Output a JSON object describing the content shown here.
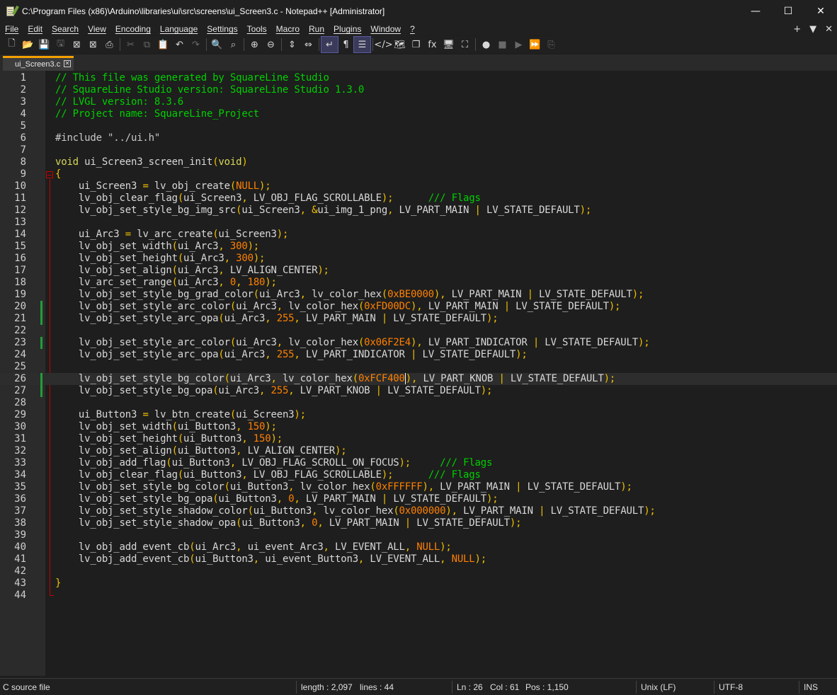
{
  "window": {
    "title": "C:\\Program Files (x86)\\Arduino\\libraries\\ui\\src\\screens\\ui_Screen3.c - Notepad++ [Administrator]",
    "controls": {
      "minimize": "—",
      "maximize": "☐",
      "close": "✕"
    }
  },
  "menu": {
    "items": [
      "File",
      "Edit",
      "Search",
      "View",
      "Encoding",
      "Language",
      "Settings",
      "Tools",
      "Macro",
      "Run",
      "Plugins",
      "Window",
      "?"
    ],
    "right": [
      "+",
      "▼",
      "✕"
    ]
  },
  "toolbar": {
    "icons": [
      {
        "name": "new-file-icon",
        "glyph": "🗋"
      },
      {
        "name": "open-file-icon",
        "glyph": "📂"
      },
      {
        "name": "save-icon",
        "glyph": "💾",
        "dim": true
      },
      {
        "name": "save-all-icon",
        "glyph": "🖫",
        "dim": true
      },
      {
        "name": "close-icon",
        "glyph": "⊠"
      },
      {
        "name": "close-all-icon",
        "glyph": "⊠"
      },
      {
        "name": "print-icon",
        "glyph": "⎙"
      },
      {
        "name": "cut-icon",
        "glyph": "✂",
        "dim": true
      },
      {
        "name": "copy-icon",
        "glyph": "⧉",
        "dim": true
      },
      {
        "name": "paste-icon",
        "glyph": "📋"
      },
      {
        "name": "undo-icon",
        "glyph": "↶"
      },
      {
        "name": "redo-icon",
        "glyph": "↷",
        "dim": true
      },
      {
        "name": "find-icon",
        "glyph": "🔍"
      },
      {
        "name": "replace-icon",
        "glyph": "⌕"
      },
      {
        "name": "zoom-in-icon",
        "glyph": "⊕"
      },
      {
        "name": "zoom-out-icon",
        "glyph": "⊖"
      },
      {
        "name": "sync-vertical-icon",
        "glyph": "⇕"
      },
      {
        "name": "sync-horizontal-icon",
        "glyph": "⇔"
      },
      {
        "name": "word-wrap-icon",
        "glyph": "↵",
        "active": true
      },
      {
        "name": "show-all-chars-icon",
        "glyph": "¶"
      },
      {
        "name": "indent-guide-icon",
        "glyph": "☰",
        "active": true
      },
      {
        "name": "xml-tag-icon",
        "glyph": "</>"
      },
      {
        "name": "document-map-icon",
        "glyph": "🗺"
      },
      {
        "name": "document-list-icon",
        "glyph": "❐"
      },
      {
        "name": "function-list-icon",
        "glyph": "fx"
      },
      {
        "name": "monitor-icon",
        "glyph": "🖥"
      },
      {
        "name": "folder-workspace-icon",
        "glyph": "⛶"
      },
      {
        "name": "record-macro-icon",
        "glyph": "●"
      },
      {
        "name": "stop-macro-icon",
        "glyph": "■",
        "dim": true
      },
      {
        "name": "play-macro-icon",
        "glyph": "▶",
        "dim": true
      },
      {
        "name": "run-macro-multiple-icon",
        "glyph": "⏩"
      },
      {
        "name": "save-macro-icon",
        "glyph": "⎘",
        "dim": true
      }
    ]
  },
  "tab": {
    "label": "ui_Screen3.c",
    "close": "✕"
  },
  "editor": {
    "current_line": 26,
    "changed_lines": [
      20,
      21,
      23,
      26,
      27
    ],
    "lines": [
      [
        [
          "cm",
          "// This file was generated by SquareLine Studio"
        ]
      ],
      [
        [
          "cm",
          "// SquareLine Studio version: SquareLine Studio 1.3.0"
        ]
      ],
      [
        [
          "cm",
          "// LVGL version: 8.3.6"
        ]
      ],
      [
        [
          "cm",
          "// Project name: SquareLine_Project"
        ]
      ],
      [],
      [
        [
          "pp",
          "#include \"../ui.h\""
        ]
      ],
      [],
      [
        [
          "kw",
          "void"
        ],
        [
          "id",
          " ui_Screen3_screen_init"
        ],
        [
          "op",
          "("
        ],
        [
          "kw",
          "void"
        ],
        [
          "op",
          ")"
        ]
      ],
      [
        [
          "op",
          "{"
        ]
      ],
      [
        [
          "id",
          "    ui_Screen3 "
        ],
        [
          "op",
          "="
        ],
        [
          "id",
          " lv_obj_create"
        ],
        [
          "op",
          "("
        ],
        [
          "num",
          "NULL"
        ],
        [
          "op",
          ");"
        ]
      ],
      [
        [
          "id",
          "    lv_obj_clear_flag"
        ],
        [
          "op",
          "("
        ],
        [
          "id",
          "ui_Screen3"
        ],
        [
          "op",
          ","
        ],
        [
          "id",
          " LV_OBJ_FLAG_SCROLLABLE"
        ],
        [
          "op",
          ");"
        ],
        [
          "id",
          "      "
        ],
        [
          "cm",
          "/// Flags"
        ]
      ],
      [
        [
          "id",
          "    lv_obj_set_style_bg_img_src"
        ],
        [
          "op",
          "("
        ],
        [
          "id",
          "ui_Screen3"
        ],
        [
          "op",
          ","
        ],
        [
          "id",
          " "
        ],
        [
          "op",
          "&"
        ],
        [
          "id",
          "ui_img_1_png"
        ],
        [
          "op",
          ","
        ],
        [
          "id",
          " LV_PART_MAIN "
        ],
        [
          "op",
          "|"
        ],
        [
          "id",
          " LV_STATE_DEFAULT"
        ],
        [
          "op",
          ");"
        ]
      ],
      [],
      [
        [
          "id",
          "    ui_Arc3 "
        ],
        [
          "op",
          "="
        ],
        [
          "id",
          " lv_arc_create"
        ],
        [
          "op",
          "("
        ],
        [
          "id",
          "ui_Screen3"
        ],
        [
          "op",
          ");"
        ]
      ],
      [
        [
          "id",
          "    lv_obj_set_width"
        ],
        [
          "op",
          "("
        ],
        [
          "id",
          "ui_Arc3"
        ],
        [
          "op",
          ","
        ],
        [
          "num",
          " 300"
        ],
        [
          "op",
          ");"
        ]
      ],
      [
        [
          "id",
          "    lv_obj_set_height"
        ],
        [
          "op",
          "("
        ],
        [
          "id",
          "ui_Arc3"
        ],
        [
          "op",
          ","
        ],
        [
          "num",
          " 300"
        ],
        [
          "op",
          ");"
        ]
      ],
      [
        [
          "id",
          "    lv_obj_set_align"
        ],
        [
          "op",
          "("
        ],
        [
          "id",
          "ui_Arc3"
        ],
        [
          "op",
          ","
        ],
        [
          "id",
          " LV_ALIGN_CENTER"
        ],
        [
          "op",
          ");"
        ]
      ],
      [
        [
          "id",
          "    lv_arc_set_range"
        ],
        [
          "op",
          "("
        ],
        [
          "id",
          "ui_Arc3"
        ],
        [
          "op",
          ","
        ],
        [
          "num",
          " 0"
        ],
        [
          "op",
          ","
        ],
        [
          "num",
          " 180"
        ],
        [
          "op",
          ");"
        ]
      ],
      [
        [
          "id",
          "    lv_obj_set_style_bg_grad_color"
        ],
        [
          "op",
          "("
        ],
        [
          "id",
          "ui_Arc3"
        ],
        [
          "op",
          ","
        ],
        [
          "id",
          " lv_color_hex"
        ],
        [
          "op",
          "("
        ],
        [
          "num",
          "0xBE0000"
        ],
        [
          "op",
          "),"
        ],
        [
          "id",
          " LV_PART_MAIN "
        ],
        [
          "op",
          "|"
        ],
        [
          "id",
          " LV_STATE_DEFAULT"
        ],
        [
          "op",
          ");"
        ]
      ],
      [
        [
          "id",
          "    lv_obj_set_style_arc_color"
        ],
        [
          "op",
          "("
        ],
        [
          "id",
          "ui_Arc3"
        ],
        [
          "op",
          ","
        ],
        [
          "id",
          " lv_color_hex"
        ],
        [
          "op",
          "("
        ],
        [
          "num",
          "0xFD00DC"
        ],
        [
          "op",
          "),"
        ],
        [
          "id",
          " LV_PART_MAIN "
        ],
        [
          "op",
          "|"
        ],
        [
          "id",
          " LV_STATE_DEFAULT"
        ],
        [
          "op",
          ");"
        ]
      ],
      [
        [
          "id",
          "    lv_obj_set_style_arc_opa"
        ],
        [
          "op",
          "("
        ],
        [
          "id",
          "ui_Arc3"
        ],
        [
          "op",
          ","
        ],
        [
          "num",
          " 255"
        ],
        [
          "op",
          ","
        ],
        [
          "id",
          " LV_PART_MAIN "
        ],
        [
          "op",
          "|"
        ],
        [
          "id",
          " LV_STATE_DEFAULT"
        ],
        [
          "op",
          ");"
        ]
      ],
      [],
      [
        [
          "id",
          "    lv_obj_set_style_arc_color"
        ],
        [
          "op",
          "("
        ],
        [
          "id",
          "ui_Arc3"
        ],
        [
          "op",
          ","
        ],
        [
          "id",
          " lv_color_hex"
        ],
        [
          "op",
          "("
        ],
        [
          "num",
          "0x06F2E4"
        ],
        [
          "op",
          "),"
        ],
        [
          "id",
          " LV_PART_INDICATOR "
        ],
        [
          "op",
          "|"
        ],
        [
          "id",
          " LV_STATE_DEFAULT"
        ],
        [
          "op",
          ");"
        ]
      ],
      [
        [
          "id",
          "    lv_obj_set_style_arc_opa"
        ],
        [
          "op",
          "("
        ],
        [
          "id",
          "ui_Arc3"
        ],
        [
          "op",
          ","
        ],
        [
          "num",
          " 255"
        ],
        [
          "op",
          ","
        ],
        [
          "id",
          " LV_PART_INDICATOR "
        ],
        [
          "op",
          "|"
        ],
        [
          "id",
          " LV_STATE_DEFAULT"
        ],
        [
          "op",
          ");"
        ]
      ],
      [],
      [
        [
          "id",
          "    lv_obj_set_style_bg_color"
        ],
        [
          "op",
          "("
        ],
        [
          "id",
          "ui_Arc3"
        ],
        [
          "op",
          ","
        ],
        [
          "id",
          " lv_color_hex"
        ],
        [
          "op",
          "("
        ],
        [
          "num",
          "0xFCF400"
        ],
        [
          "cur",
          ""
        ],
        [
          "op",
          "),"
        ],
        [
          "id",
          " LV_PART_KNOB "
        ],
        [
          "op",
          "|"
        ],
        [
          "id",
          " LV_STATE_DEFAULT"
        ],
        [
          "op",
          ");"
        ]
      ],
      [
        [
          "id",
          "    lv_obj_set_style_bg_opa"
        ],
        [
          "op",
          "("
        ],
        [
          "id",
          "ui_Arc3"
        ],
        [
          "op",
          ","
        ],
        [
          "num",
          " 255"
        ],
        [
          "op",
          ","
        ],
        [
          "id",
          " LV_PART_KNOB "
        ],
        [
          "op",
          "|"
        ],
        [
          "id",
          " LV_STATE_DEFAULT"
        ],
        [
          "op",
          ");"
        ]
      ],
      [],
      [
        [
          "id",
          "    ui_Button3 "
        ],
        [
          "op",
          "="
        ],
        [
          "id",
          " lv_btn_create"
        ],
        [
          "op",
          "("
        ],
        [
          "id",
          "ui_Screen3"
        ],
        [
          "op",
          ");"
        ]
      ],
      [
        [
          "id",
          "    lv_obj_set_width"
        ],
        [
          "op",
          "("
        ],
        [
          "id",
          "ui_Button3"
        ],
        [
          "op",
          ","
        ],
        [
          "num",
          " 150"
        ],
        [
          "op",
          ");"
        ]
      ],
      [
        [
          "id",
          "    lv_obj_set_height"
        ],
        [
          "op",
          "("
        ],
        [
          "id",
          "ui_Button3"
        ],
        [
          "op",
          ","
        ],
        [
          "num",
          " 150"
        ],
        [
          "op",
          ");"
        ]
      ],
      [
        [
          "id",
          "    lv_obj_set_align"
        ],
        [
          "op",
          "("
        ],
        [
          "id",
          "ui_Button3"
        ],
        [
          "op",
          ","
        ],
        [
          "id",
          " LV_ALIGN_CENTER"
        ],
        [
          "op",
          ");"
        ]
      ],
      [
        [
          "id",
          "    lv_obj_add_flag"
        ],
        [
          "op",
          "("
        ],
        [
          "id",
          "ui_Button3"
        ],
        [
          "op",
          ","
        ],
        [
          "id",
          " LV_OBJ_FLAG_SCROLL_ON_FOCUS"
        ],
        [
          "op",
          ");"
        ],
        [
          "id",
          "     "
        ],
        [
          "cm",
          "/// Flags"
        ]
      ],
      [
        [
          "id",
          "    lv_obj_clear_flag"
        ],
        [
          "op",
          "("
        ],
        [
          "id",
          "ui_Button3"
        ],
        [
          "op",
          ","
        ],
        [
          "id",
          " LV_OBJ_FLAG_SCROLLABLE"
        ],
        [
          "op",
          ");"
        ],
        [
          "id",
          "      "
        ],
        [
          "cm",
          "/// Flags"
        ]
      ],
      [
        [
          "id",
          "    lv_obj_set_style_bg_color"
        ],
        [
          "op",
          "("
        ],
        [
          "id",
          "ui_Button3"
        ],
        [
          "op",
          ","
        ],
        [
          "id",
          " lv_color_hex"
        ],
        [
          "op",
          "("
        ],
        [
          "num",
          "0xFFFFFF"
        ],
        [
          "op",
          "),"
        ],
        [
          "id",
          " LV_PART_MAIN "
        ],
        [
          "op",
          "|"
        ],
        [
          "id",
          " LV_STATE_DEFAULT"
        ],
        [
          "op",
          ");"
        ]
      ],
      [
        [
          "id",
          "    lv_obj_set_style_bg_opa"
        ],
        [
          "op",
          "("
        ],
        [
          "id",
          "ui_Button3"
        ],
        [
          "op",
          ","
        ],
        [
          "num",
          " 0"
        ],
        [
          "op",
          ","
        ],
        [
          "id",
          " LV_PART_MAIN "
        ],
        [
          "op",
          "|"
        ],
        [
          "id",
          " LV_STATE_DEFAULT"
        ],
        [
          "op",
          ");"
        ]
      ],
      [
        [
          "id",
          "    lv_obj_set_style_shadow_color"
        ],
        [
          "op",
          "("
        ],
        [
          "id",
          "ui_Button3"
        ],
        [
          "op",
          ","
        ],
        [
          "id",
          " lv_color_hex"
        ],
        [
          "op",
          "("
        ],
        [
          "num",
          "0x000000"
        ],
        [
          "op",
          "),"
        ],
        [
          "id",
          " LV_PART_MAIN "
        ],
        [
          "op",
          "|"
        ],
        [
          "id",
          " LV_STATE_DEFAULT"
        ],
        [
          "op",
          ");"
        ]
      ],
      [
        [
          "id",
          "    lv_obj_set_style_shadow_opa"
        ],
        [
          "op",
          "("
        ],
        [
          "id",
          "ui_Button3"
        ],
        [
          "op",
          ","
        ],
        [
          "num",
          " 0"
        ],
        [
          "op",
          ","
        ],
        [
          "id",
          " LV_PART_MAIN "
        ],
        [
          "op",
          "|"
        ],
        [
          "id",
          " LV_STATE_DEFAULT"
        ],
        [
          "op",
          ");"
        ]
      ],
      [],
      [
        [
          "id",
          "    lv_obj_add_event_cb"
        ],
        [
          "op",
          "("
        ],
        [
          "id",
          "ui_Arc3"
        ],
        [
          "op",
          ","
        ],
        [
          "id",
          " ui_event_Arc3"
        ],
        [
          "op",
          ","
        ],
        [
          "id",
          " LV_EVENT_ALL"
        ],
        [
          "op",
          ","
        ],
        [
          "num",
          " NULL"
        ],
        [
          "op",
          ");"
        ]
      ],
      [
        [
          "id",
          "    lv_obj_add_event_cb"
        ],
        [
          "op",
          "("
        ],
        [
          "id",
          "ui_Button3"
        ],
        [
          "op",
          ","
        ],
        [
          "id",
          " ui_event_Button3"
        ],
        [
          "op",
          ","
        ],
        [
          "id",
          " LV_EVENT_ALL"
        ],
        [
          "op",
          ","
        ],
        [
          "num",
          " NULL"
        ],
        [
          "op",
          ");"
        ]
      ],
      [],
      [
        [
          "op",
          "}"
        ]
      ],
      []
    ]
  },
  "status": {
    "file_type": "C source file",
    "length": "length : 2,097",
    "lines": "lines : 44",
    "ln": "Ln : 26",
    "col": "Col : 61",
    "pos": "Pos : 1,150",
    "eol": "Unix (LF)",
    "encoding": "UTF-8",
    "mode": "INS"
  },
  "colors": {
    "comment": "#00d000",
    "keyword": "#d7d75a",
    "operator": "#f0c000",
    "number": "#ff8000",
    "tab_accent": "#f5a000",
    "fold_marker": "#c80000",
    "change_marker": "#1f9e3a"
  }
}
